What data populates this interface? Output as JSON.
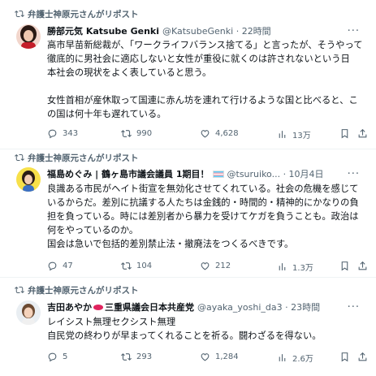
{
  "tweets": [
    {
      "repost_label": "弁護士神原元さんがリポスト",
      "name": "勝部元気 Katsube Genki",
      "handle": "@KatsubeGenki · 22時間",
      "lines": [
        "高市早苗新総裁が、「ワークライフバランス捨てる」と言ったが、そうやって",
        "徹底的に男社会に適応しないと女性が重役に就くのは許されないという日",
        "本社会の現状をよく表していると思う。",
        "",
        "女性首相が産休取って国連に赤ん坊を連れて行けるような国と比べると、こ",
        "の国は何十年も遅れている。"
      ],
      "replies": "343",
      "reposts": "990",
      "likes": "4,628",
      "views": "13万"
    },
    {
      "repost_label": "弁護士神原元さんがリポスト",
      "name": "福島めぐみ | 鶴ヶ島市議会議員 1期目！",
      "handle": "@tsuruiko... · 10月4日",
      "lines": [
        "良識ある市民がヘイト街宣を無効化させてくれている。社会の危機を感じて",
        "いるからだ。差別に抗議する人たちは金銭的・時間的・精神的にかなりの負",
        "担を負っている。時には差別者から暴力を受けてケガを負うことも。政治は",
        "何をやっているのか。",
        "国会は急いで包括的差別禁止法・撤廃法をつくるべきです。"
      ],
      "replies": "47",
      "reposts": "104",
      "likes": "212",
      "views": "1.3万"
    },
    {
      "repost_label": "弁護士神原元さんがリポスト",
      "name_a": "吉田あやか",
      "name_b": "三重県議会日本共産党",
      "handle": "@ayaka_yoshi_da3 · 23時間",
      "lines": [
        "レイシスト無理セクシスト無理",
        "自民党の終わりが早まってくれることを祈る。闘わざるを得ない。"
      ],
      "replies": "5",
      "reposts": "293",
      "likes": "1,284",
      "views": "2.6万"
    }
  ],
  "icons": {
    "repost": "repost-icon",
    "reply": "reply-icon",
    "like": "heart-icon",
    "views": "views-icon",
    "more": "more-icon"
  },
  "colors": {
    "secondary": "#536471",
    "primary_text": "#0f1419",
    "divider": "#eff3f4"
  }
}
